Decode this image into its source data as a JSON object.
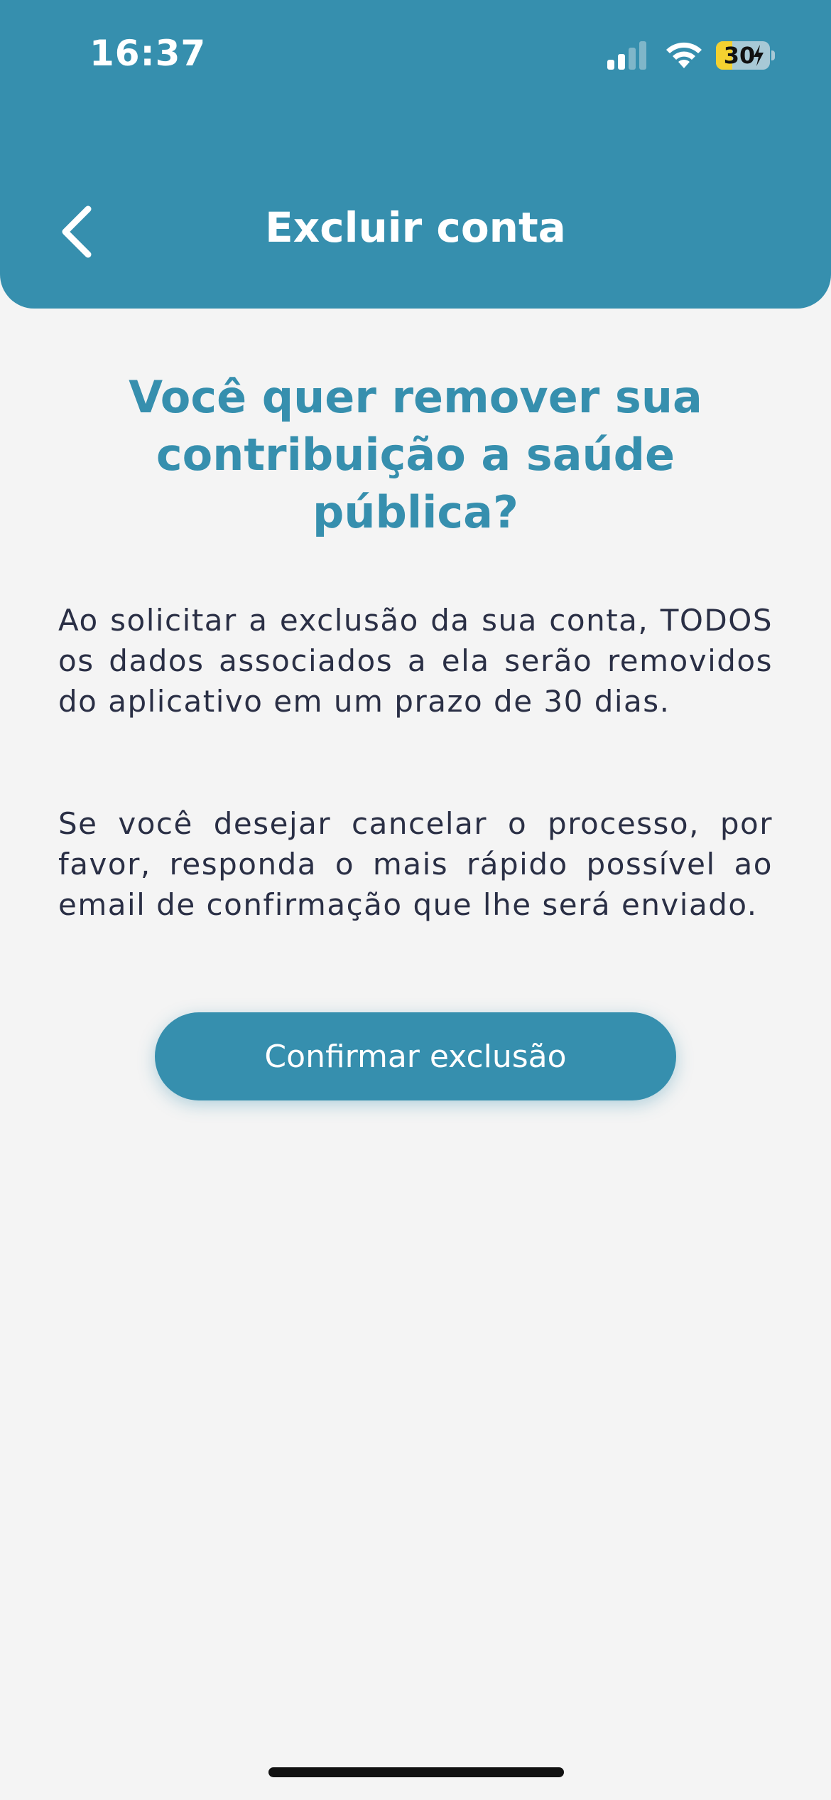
{
  "status_bar": {
    "time": "16:37",
    "battery_level": "30",
    "battery_percent": 30,
    "charging": true,
    "signal_bars_active": 2,
    "signal_bars_total": 4,
    "icons": [
      "signal-icon",
      "wifi-icon",
      "battery-icon",
      "bolt-icon"
    ]
  },
  "header": {
    "title": "Excluir conta",
    "back_icon": "chevron-left-icon"
  },
  "main": {
    "headline": "Você quer remover sua contribuição a saúde pública?",
    "paragraph_1": "Ao solicitar a exclusão da sua conta, TODOS os dados associados a ela serão removidos do aplicativo em um prazo de 30 dias.",
    "paragraph_2": "Se você desejar cancelar o processo, por favor, responda o mais rápido possível ao email de confirmação que lhe será enviado.",
    "confirm_button_label": "Confirmar exclusão"
  },
  "colors": {
    "primary": "#368fae",
    "background": "#f4f4f4",
    "text": "#2a2f45",
    "battery_fill": "#f4d130"
  }
}
